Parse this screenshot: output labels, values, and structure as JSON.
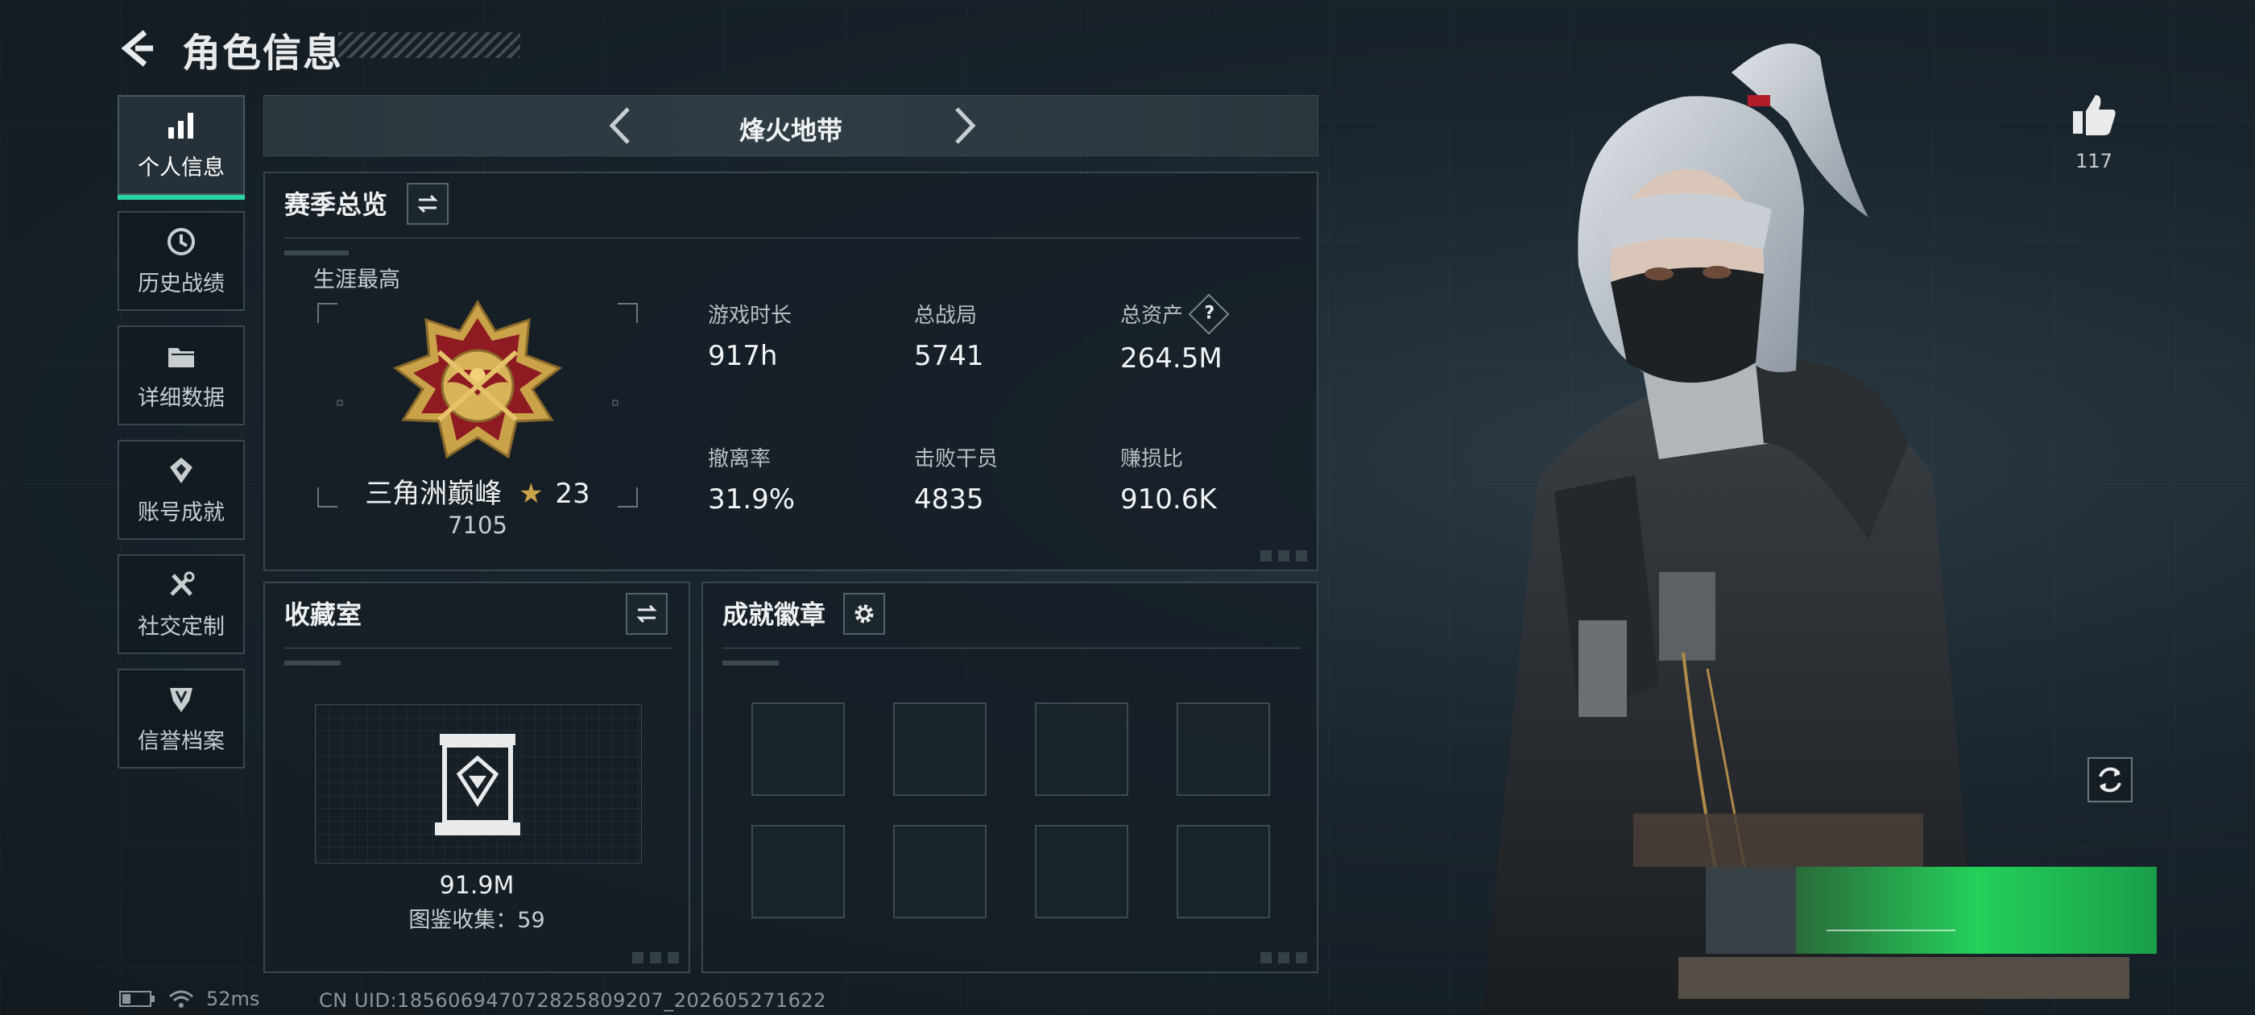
{
  "header": {
    "title": "角色信息",
    "back_icon": "back-arrow-icon"
  },
  "sidebar": {
    "items": [
      {
        "label": "个人信息",
        "icon": "bar-chart-icon",
        "active": true
      },
      {
        "label": "历史战绩",
        "icon": "history-clock-icon",
        "active": false
      },
      {
        "label": "详细数据",
        "icon": "folder-icon",
        "active": false
      },
      {
        "label": "账号成就",
        "icon": "achievement-badge-icon",
        "active": false
      },
      {
        "label": "社交定制",
        "icon": "tools-icon",
        "active": false
      },
      {
        "label": "信誉档案",
        "icon": "shield-emblem-icon",
        "active": false
      }
    ]
  },
  "map_tab": {
    "name": "烽火地带"
  },
  "season": {
    "title": "赛季总览",
    "career_label": "生涯最高",
    "rank_name": "三角洲巅峰",
    "rank_stars": "23",
    "rank_score": "7105",
    "stats": [
      {
        "label": "游戏时长",
        "value": "917h"
      },
      {
        "label": "总战局",
        "value": "5741"
      },
      {
        "label": "总资产",
        "value": "264.5M",
        "help": "?"
      },
      {
        "label": "撤离率",
        "value": "31.9%"
      },
      {
        "label": "击败干员",
        "value": "4835"
      },
      {
        "label": "赚损比",
        "value": "910.6K"
      }
    ]
  },
  "collection": {
    "title": "收藏室",
    "value": "91.9M",
    "count_text": "图鉴收集：59"
  },
  "achievements": {
    "title": "成就徽章",
    "slots": 8
  },
  "likes": {
    "count": "117"
  },
  "status_bar": {
    "ping": "52ms",
    "uid": "CN UID:185606947072825809207_202605271622"
  },
  "colors": {
    "accent": "#2cd3a5",
    "panel_bg": "#161f26",
    "border": "#3a454c",
    "medal_gold": "#c9a24a",
    "medal_red": "#8e1b22"
  }
}
